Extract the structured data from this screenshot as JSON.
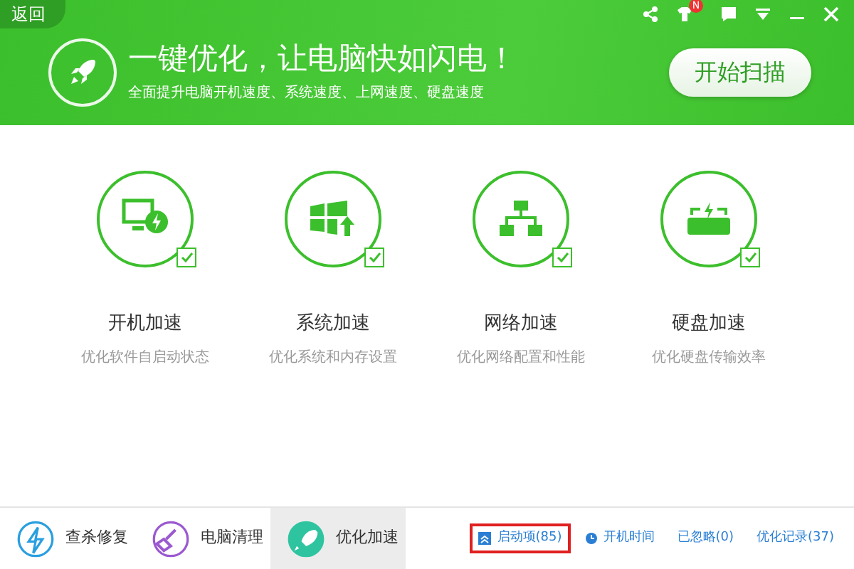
{
  "header": {
    "back_button": "返回",
    "title": "一键优化，让电脑快如闪电！",
    "subtitle": "全面提升电脑开机速度、系统速度、上网速度、硬盘速度",
    "scan_button": "开始扫描",
    "notification_badge": "N"
  },
  "items": [
    {
      "kind": "boot",
      "title": "开机加速",
      "description": "优化软件自启动状态",
      "checked": true
    },
    {
      "kind": "system",
      "title": "系统加速",
      "description": "优化系统和内存设置",
      "checked": true
    },
    {
      "kind": "network",
      "title": "网络加速",
      "description": "优化网络配置和性能",
      "checked": true
    },
    {
      "kind": "disk",
      "title": "硬盘加速",
      "description": "优化硬盘传输效率",
      "checked": true
    }
  ],
  "bottom_tabs": [
    {
      "kind": "scan",
      "label": "查杀修复",
      "selected": false
    },
    {
      "kind": "clean",
      "label": "电脑清理",
      "selected": false
    },
    {
      "kind": "speed",
      "label": "优化加速",
      "selected": true
    }
  ],
  "footer_links": [
    {
      "label": "启动项(85)",
      "highlighted": true
    },
    {
      "label": "开机时间",
      "highlighted": false
    },
    {
      "label": "已忽略(0)",
      "highlighted": false
    },
    {
      "label": "优化记录(37)",
      "highlighted": false
    }
  ]
}
